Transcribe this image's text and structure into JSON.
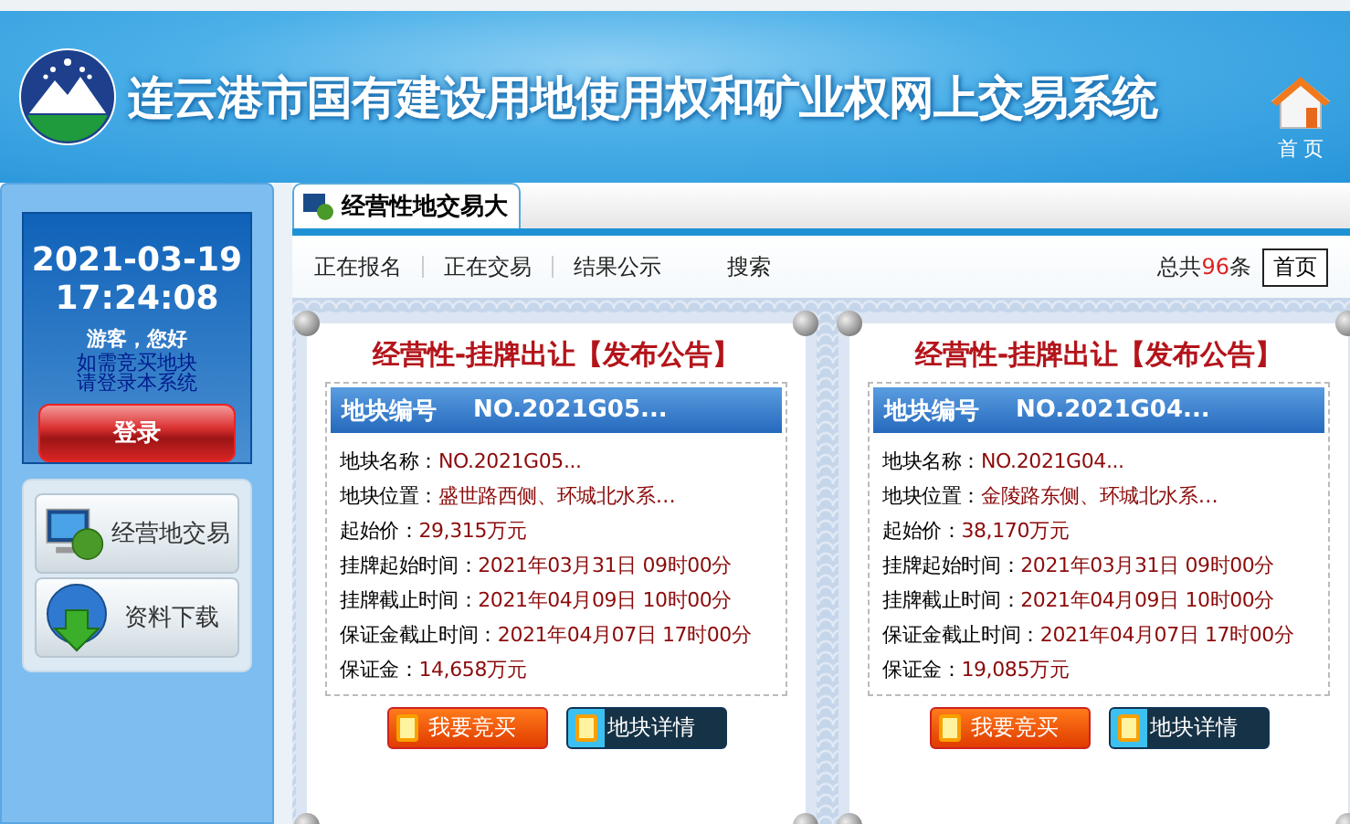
{
  "header": {
    "title": "连云港市国有建设用地使用权和矿业权网上交易系统",
    "home_label": "首 页"
  },
  "sidebar": {
    "date": "2021-03-19",
    "time": "17:24:08",
    "greeting": "游客，您好",
    "hint_lines": [
      "如需竞买地块",
      "请登录本系统"
    ],
    "login_button": "登录",
    "menu": [
      {
        "label": "经营地交易",
        "kind": "monitor"
      },
      {
        "label": "资料下载",
        "kind": "download"
      }
    ]
  },
  "tabs": [
    {
      "label": "经营性地交易大",
      "selected": true
    }
  ],
  "nav": [
    {
      "label": "正在报名"
    },
    {
      "label": "正在交易"
    },
    {
      "label": "结果公示"
    },
    {
      "label": "搜索"
    }
  ],
  "pager": {
    "prefix": "总共",
    "count": "96",
    "suffix": "条",
    "buttons": [
      "首页"
    ]
  },
  "cards": [
    {
      "title": "经营性-挂牌出让【发布公告】",
      "code_label": "地块编号",
      "code_value": "NO.2021G05...",
      "fields": [
        {
          "label": "地块名称：",
          "value": "NO.2021G05..."
        },
        {
          "label": "地块位置：",
          "value": "盛世路西侧、环城北水系…"
        },
        {
          "label": "起始价：",
          "value": "29,315万元"
        },
        {
          "label": "挂牌起始时间：",
          "value": "2021年03月31日 09时00分"
        },
        {
          "label": "挂牌截止时间：",
          "value": "2021年04月09日 10时00分"
        },
        {
          "label": "保证金截止时间：",
          "value": "2021年04月07日 17时00分"
        },
        {
          "label": "保证金：",
          "value": "14,658万元"
        }
      ],
      "buttons": [
        {
          "label": "我要竞买",
          "kind": "bid"
        },
        {
          "label": "地块详情",
          "kind": "detail"
        }
      ]
    },
    {
      "title": "经营性-挂牌出让【发布公告】",
      "code_label": "地块编号",
      "code_value": "NO.2021G04...",
      "fields": [
        {
          "label": "地块名称：",
          "value": "NO.2021G04..."
        },
        {
          "label": "地块位置：",
          "value": "金陵路东侧、环城北水系…"
        },
        {
          "label": "起始价：",
          "value": "38,170万元"
        },
        {
          "label": "挂牌起始时间：",
          "value": "2021年03月31日 09时00分"
        },
        {
          "label": "挂牌截止时间：",
          "value": "2021年04月09日 10时00分"
        },
        {
          "label": "保证金截止时间：",
          "value": "2021年04月07日 17时00分"
        },
        {
          "label": "保证金：",
          "value": "19,085万元"
        }
      ],
      "buttons": [
        {
          "label": "我要竞买",
          "kind": "bid"
        },
        {
          "label": "地块详情",
          "kind": "detail"
        }
      ]
    }
  ]
}
